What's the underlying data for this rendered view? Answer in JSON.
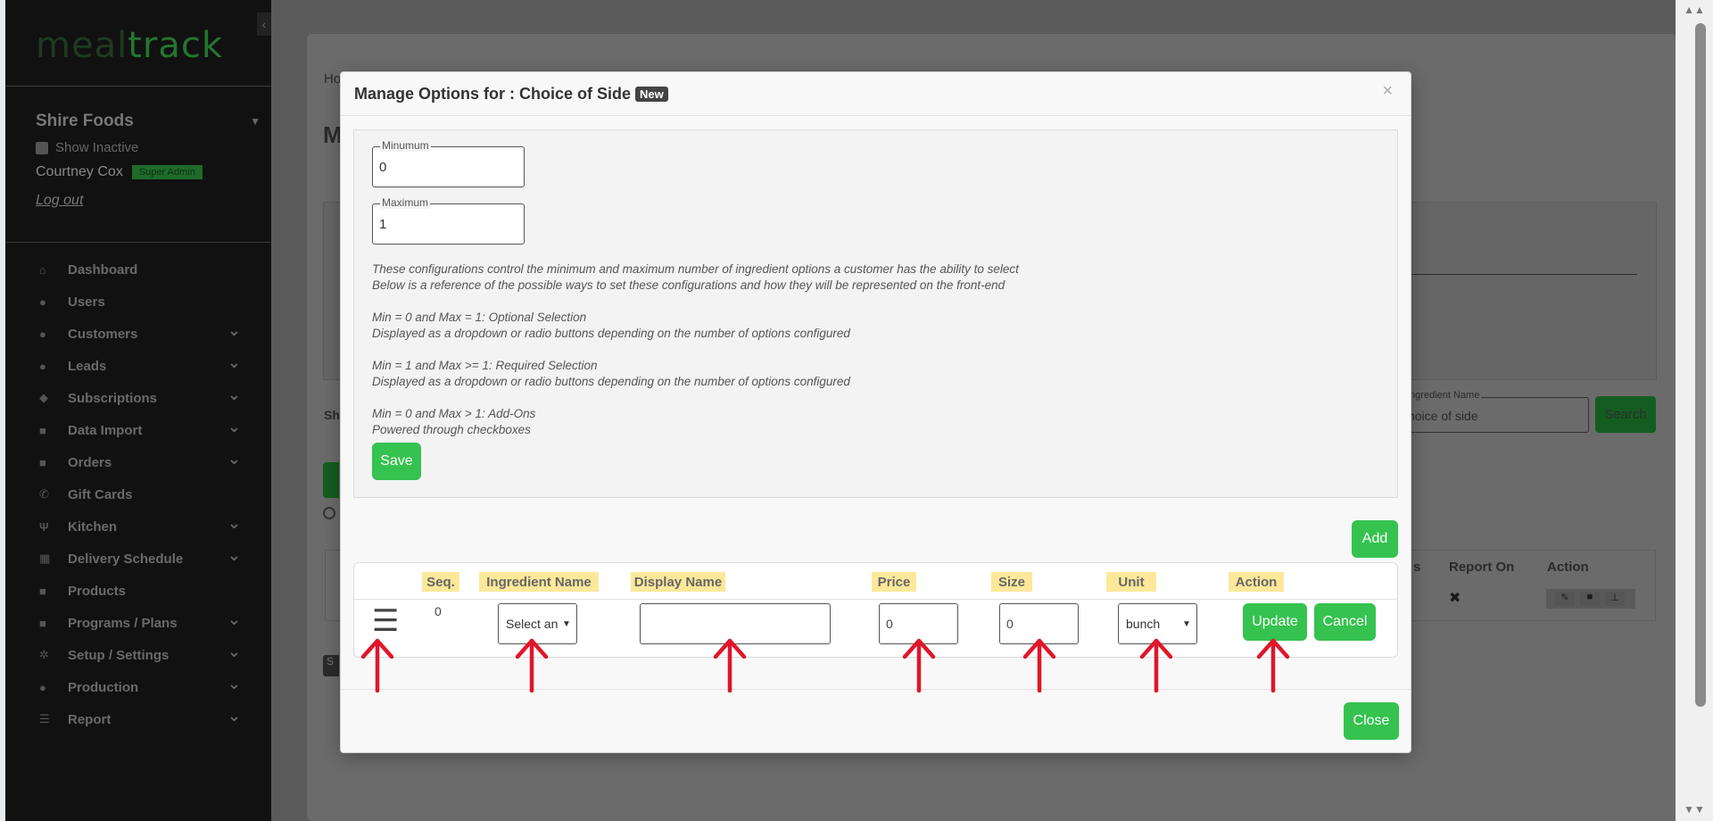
{
  "sidebar": {
    "logo_part1": "meal",
    "logo_part2": "track",
    "company": "Shire Foods",
    "show_inactive": "Show Inactive",
    "user_name": "Courtney Cox",
    "role_badge": "Super Admin",
    "logout": "Log out",
    "nav": [
      {
        "label": "Dashboard",
        "icon": "home-icon",
        "glyph": "⌂",
        "chevron": false
      },
      {
        "label": "Users",
        "icon": "user-icon",
        "glyph": "●",
        "chevron": false
      },
      {
        "label": "Customers",
        "icon": "users-icon",
        "glyph": "●",
        "chevron": true
      },
      {
        "label": "Leads",
        "icon": "dollar-icon",
        "glyph": "●",
        "chevron": true
      },
      {
        "label": "Subscriptions",
        "icon": "layers-icon",
        "glyph": "◆",
        "chevron": true
      },
      {
        "label": "Data Import",
        "icon": "file-icon",
        "glyph": "■",
        "chevron": true
      },
      {
        "label": "Orders",
        "icon": "bag-icon",
        "glyph": "■",
        "chevron": true
      },
      {
        "label": "Gift Cards",
        "icon": "phone-icon",
        "glyph": "✆",
        "chevron": false
      },
      {
        "label": "Kitchen",
        "icon": "utensils-icon",
        "glyph": "Ψ",
        "chevron": true
      },
      {
        "label": "Delivery Schedule",
        "icon": "calendar-icon",
        "glyph": "▦",
        "chevron": true
      },
      {
        "label": "Products",
        "icon": "box-icon",
        "glyph": "■",
        "chevron": false
      },
      {
        "label": "Programs / Plans",
        "icon": "clipboard-icon",
        "glyph": "■",
        "chevron": true
      },
      {
        "label": "Setup / Settings",
        "icon": "gear-icon",
        "glyph": "✲",
        "chevron": true
      },
      {
        "label": "Production",
        "icon": "person-icon",
        "glyph": "●",
        "chevron": true
      },
      {
        "label": "Report",
        "icon": "list-icon",
        "glyph": "☰",
        "chevron": true
      }
    ]
  },
  "background": {
    "crumb": "Ho",
    "title": "M",
    "sh": "Sh",
    "search_label": "Ingredient Name",
    "search_value": "hoice of side",
    "search_button": "Search",
    "col_s": "s",
    "col_report_on": "Report On",
    "col_action": "Action",
    "s_button": "S"
  },
  "modal": {
    "title": "Manage Options for : Choice of Side",
    "badge": "New",
    "close_x": "×",
    "minimum_label": "Minumum",
    "minimum_value": "0",
    "maximum_label": "Maximum",
    "maximum_value": "1",
    "info": [
      "These configurations control the minimum and maximum number of ingredient options a customer has the ability to select",
      "Below is a reference of the possible ways to set these configurations and how they will be represented on the front-end",
      "",
      "Min = 0 and Max = 1: Optional Selection",
      "Displayed as a dropdown or radio buttons depending on the number of options configured",
      "",
      "Min = 1 and Max >= 1: Required Selection",
      "Displayed as a dropdown or radio buttons depending on the number of options configured",
      "",
      "Min = 0 and Max > 1: Add-Ons",
      "Powered through checkboxes"
    ],
    "save_button": "Save",
    "add_button": "Add",
    "columns": [
      "Seq.",
      "Ingredient Name",
      "Display Name",
      "Price",
      "Size",
      "Unit",
      "Action"
    ],
    "row": {
      "seq": "0",
      "ingredient_select": "Select an",
      "display_name": "",
      "price": "0",
      "size": "0",
      "unit": "bunch",
      "update_button": "Update",
      "cancel_button": "Cancel"
    },
    "close_button": "Close"
  },
  "colors": {
    "green": "#35c24f",
    "highlight": "#fde89a",
    "arrow": "#e0162b"
  }
}
